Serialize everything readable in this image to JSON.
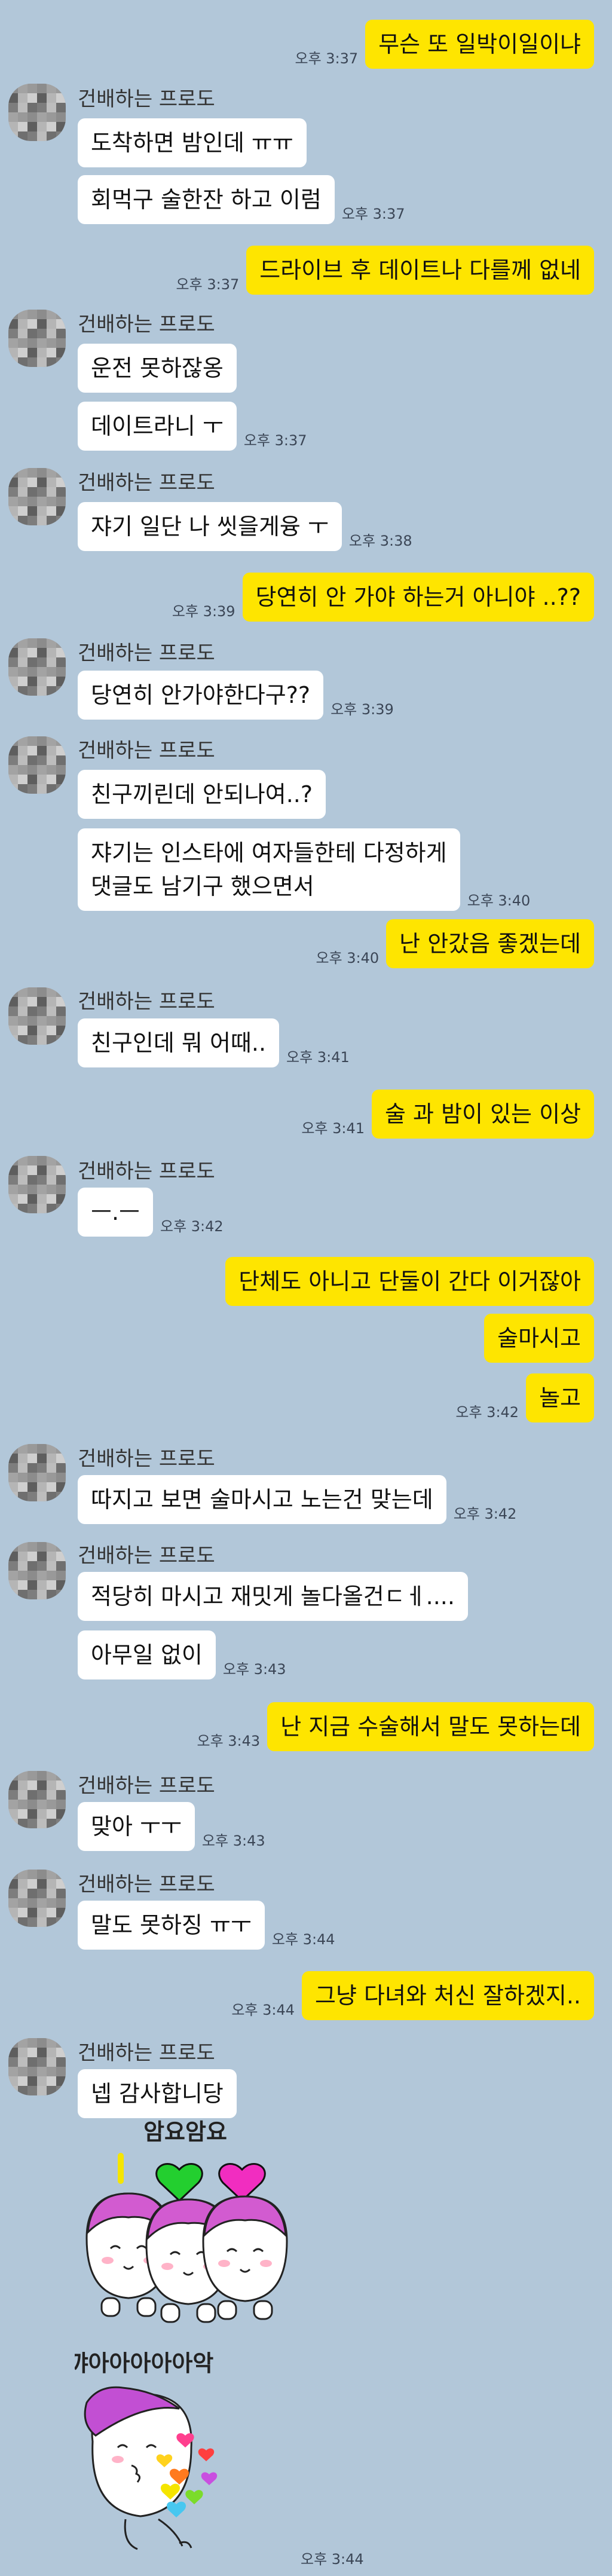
{
  "sender_name": "건배하는 프로도",
  "messages": [
    {
      "side": "me",
      "text": "무슨 또 일박이일이냐",
      "time": "오후 3:37"
    },
    {
      "side": "them",
      "text": "도착하면 밤인데 ㅠㅠ"
    },
    {
      "side": "them",
      "text": "회먹구 술한잔 하고 이럼",
      "time": "오후 3:37"
    },
    {
      "side": "me",
      "text": "드라이브 후 데이트나 다를께 없네",
      "time": "오후 3:37"
    },
    {
      "side": "them",
      "text": "운전 못하잖옹"
    },
    {
      "side": "them",
      "text": "데이트라니 ㅜ",
      "time": "오후 3:37"
    },
    {
      "side": "them",
      "text": "쟈기 일단 나 씻을게융 ㅜ",
      "time": "오후 3:38"
    },
    {
      "side": "me",
      "text": "당연히 안 가야 하는거 아니야 ..??",
      "time": "오후 3:39"
    },
    {
      "side": "them",
      "text": "당연히 안가야한다구??",
      "time": "오후 3:39"
    },
    {
      "side": "them",
      "text": "친구끼린데 안되나여..?"
    },
    {
      "side": "them",
      "text": "쟈기는 인스타에 여자들한테 다정하게\n댓글도 남기구 했으면서",
      "time": "오후 3:40"
    },
    {
      "side": "me",
      "text": "난 안갔음 좋겠는데",
      "time": "오후 3:40"
    },
    {
      "side": "them",
      "text": "친구인데 뭐 어때..",
      "time": "오후 3:41"
    },
    {
      "side": "me",
      "text": "술 과 밤이 있는 이상",
      "time": "오후 3:41"
    },
    {
      "side": "them",
      "text": "ㅡ.ㅡ",
      "time": "오후 3:42"
    },
    {
      "side": "me",
      "text": "단체도 아니고 단둘이 간다 이거잖아"
    },
    {
      "side": "me",
      "text": "술마시고"
    },
    {
      "side": "me",
      "text": "놀고",
      "time": "오후 3:42"
    },
    {
      "side": "them",
      "text": "따지고 보면 술마시고 노는건 맞는데",
      "time": "오후 3:42"
    },
    {
      "side": "them",
      "text": "적당히 마시고 재밋게 놀다올건ㄷㅔ...."
    },
    {
      "side": "them",
      "text": "아무일 없이",
      "time": "오후 3:43"
    },
    {
      "side": "me",
      "text": "난 지금 수술해서 말도 못하는데",
      "time": "오후 3:43"
    },
    {
      "side": "them",
      "text": "맞아 ㅜㅜ",
      "time": "오후 3:43"
    },
    {
      "side": "them",
      "text": "말도 못하징 ㅠㅜ",
      "time": "오후 3:44"
    },
    {
      "side": "me",
      "text": "그냥 다녀와 처신 잘하겠지..",
      "time": "오후 3:44"
    },
    {
      "side": "them",
      "text": "넵 감사합니당"
    }
  ],
  "stickers": {
    "caption_top": "암요암요",
    "caption_bottom": "꺄아아아아아악",
    "time": "오후 3:44"
  }
}
